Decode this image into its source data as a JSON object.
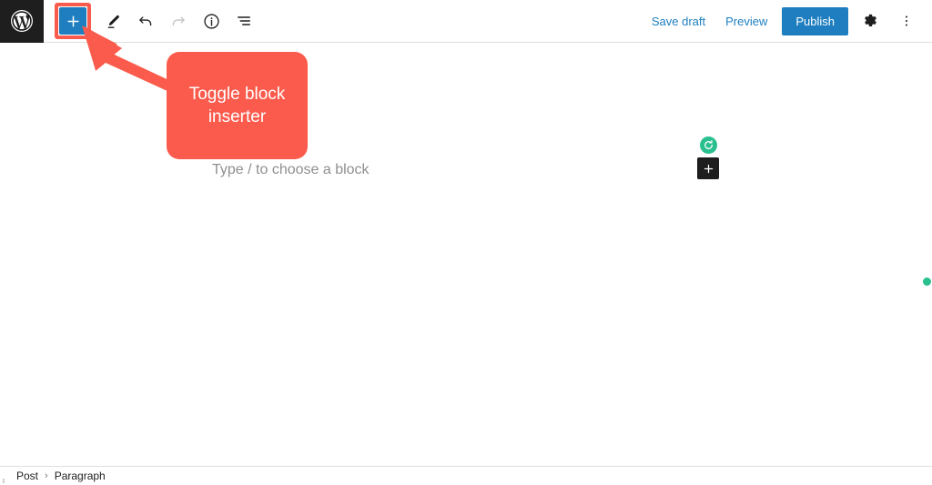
{
  "header": {
    "logo": {
      "name": "wordpress-logo",
      "alt": "WordPress"
    },
    "toolbar_left": [
      {
        "name": "toggle-block-inserter",
        "label": "Toggle block inserter",
        "icon": "plus-icon",
        "state": "highlighted"
      },
      {
        "name": "tools-pen",
        "label": "Tools",
        "icon": "pen-icon"
      },
      {
        "name": "undo",
        "label": "Undo",
        "icon": "undo-arrow-icon",
        "disabled": false
      },
      {
        "name": "redo",
        "label": "Redo",
        "icon": "redo-arrow-icon",
        "disabled": true
      },
      {
        "name": "details",
        "label": "Details",
        "icon": "info-circle-icon"
      },
      {
        "name": "list-view",
        "label": "List View",
        "icon": "list-view-icon"
      }
    ],
    "save_draft_label": "Save draft",
    "preview_label": "Preview",
    "publish_label": "Publish",
    "settings_label": "Settings",
    "options_label": "Options"
  },
  "canvas": {
    "paragraph_placeholder": "Type / to choose a block",
    "float_widget": {
      "refresh_label": "Reload",
      "add_block_label": "Add block"
    }
  },
  "callout": {
    "text": "Toggle block inserter",
    "color": "#fb5b4c"
  },
  "bottombar": {
    "breadcrumb": [
      {
        "label": "Post"
      },
      {
        "label": "Paragraph"
      }
    ],
    "separator": "›"
  },
  "colors": {
    "accent_blue": "#1e7ec0",
    "callout_coral": "#fb5b4c",
    "green": "#29bf8f",
    "dark": "#1e1e1e",
    "placeholder_gray": "#8f8f8f"
  }
}
